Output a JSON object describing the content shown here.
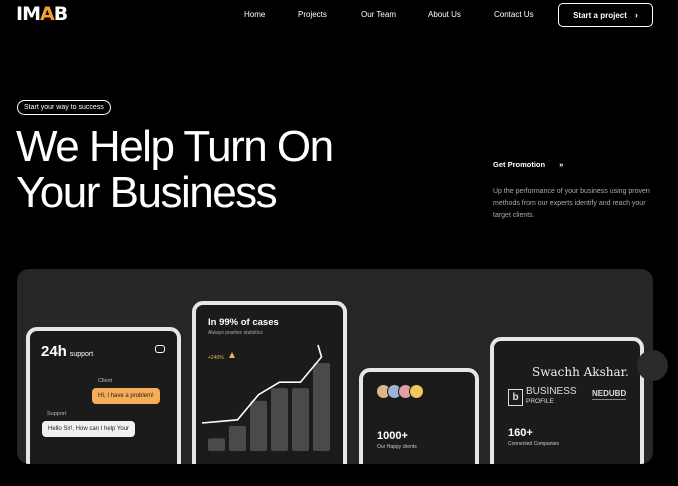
{
  "brand": {
    "logo_text": "IMAB",
    "accent_color": "#f59e2c"
  },
  "nav": {
    "items": [
      "Home",
      "Projects",
      "Our Team",
      "About Us",
      "Contact Us"
    ],
    "cta_label": "Start a project"
  },
  "hero": {
    "pill": "Start your way to success",
    "title_line1": "We Help Turn On",
    "title_line2": "Your Business",
    "promo_link": "Get Promotion",
    "description": "Up the performance of your business using proven methods from our experts identify and reach your target clients."
  },
  "cards": {
    "support": {
      "headline": "24h",
      "headline_suffix": "support",
      "client_label": "Client",
      "client_msg": "HI, I have a problem!",
      "support_label": "Support",
      "support_msg": "Hello Sir!, How can I help Your"
    },
    "cases": {
      "headline": "In 99% of cases",
      "subtitle": "Always positive statistics",
      "growth": "+240%",
      "bars": [
        1,
        2,
        4,
        5,
        5,
        7
      ]
    },
    "clients": {
      "count": "1000+",
      "caption": "Our Happy clients"
    },
    "companies": {
      "partner_script": "Swachh Akshar.",
      "partner_business": "BUSINESS",
      "partner_profile": "PROFILE",
      "partner_nedubd": "NEDUBD",
      "count": "160+",
      "caption": "Connected Companies"
    }
  }
}
